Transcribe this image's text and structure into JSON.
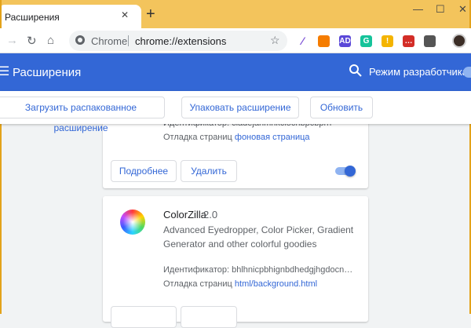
{
  "window": {
    "tab_title": "Расширения",
    "tab_close": "✕",
    "new_tab": "+",
    "minimize": "—",
    "maximize": "☐",
    "close": "✕"
  },
  "toolbar": {
    "back": "←",
    "forward": "→",
    "reload": "↻",
    "home": "⌂",
    "omnibox_scheme": "Chrome",
    "omnibox_url": "chrome://extensions",
    "bookmark": "☆"
  },
  "extensions_toolbar": [
    {
      "icon": "feather-icon",
      "glyph": "",
      "color": "#7b4fd6"
    },
    {
      "icon": "half-circle-icon",
      "glyph": "",
      "color": "#f57c00"
    },
    {
      "icon": "adblock-icon",
      "glyph": "AD",
      "color": "#5b48d8"
    },
    {
      "icon": "grammarly-icon",
      "glyph": "G",
      "color": "#15c39a"
    },
    {
      "icon": "keep-icon",
      "glyph": "!",
      "color": "#f4b400"
    },
    {
      "icon": "lastpass-icon",
      "glyph": "…",
      "color": "#d32d27"
    },
    {
      "icon": "eyedropper-icon",
      "glyph": "",
      "color": "#555555"
    }
  ],
  "header": {
    "title": "Расширения",
    "dev_mode_label": "Режим разработчика"
  },
  "actions": {
    "load_unpacked": "Загрузить распакованное расширение",
    "pack": "Упаковать расширение",
    "update": "Обновить"
  },
  "card1": {
    "id_line": "Идентификатор: cladejahmhkclocnbpcbprh",
    "inspect_label": "Отладка страниц",
    "inspect_link": "фоновая страница",
    "details": "Подробнее",
    "remove": "Удалить",
    "enabled": true
  },
  "card2": {
    "name": "ColorZilla",
    "version": "2.0",
    "description": "Advanced Eyedropper, Color Picker, Gradient Generator and other colorful goodies",
    "id_line": "Идентификатор: bhlhnicpbhignbdhedgjhgdocn…",
    "inspect_label": "Отладка страниц",
    "inspect_link": "html/background.html"
  },
  "colors": {
    "accent": "#3367d6",
    "titlebar": "#f3c45c",
    "background": "#f1f3f4"
  }
}
